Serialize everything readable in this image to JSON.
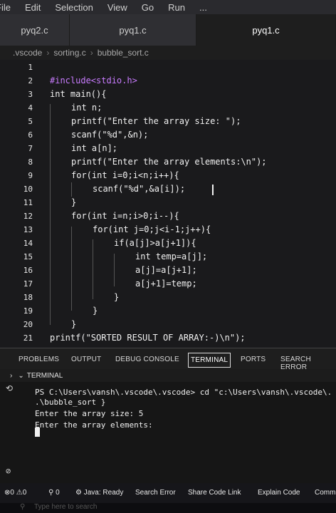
{
  "menubar": {
    "items": [
      "File",
      "Edit",
      "Selection",
      "View",
      "Go",
      "Run",
      "..."
    ]
  },
  "tabs": [
    {
      "label": "pyq2.c"
    },
    {
      "label": "pyq1.c"
    },
    {
      "label": "pyq1.c"
    }
  ],
  "breadcrumb": {
    "parts": [
      ".vscode",
      "sorting.c",
      "bubble_sort.c"
    ]
  },
  "editor": {
    "line_numbers": [
      "1",
      "2",
      "3",
      "4",
      "5",
      "6",
      "7",
      "8",
      "9",
      "10",
      "11",
      "12",
      "13",
      "14",
      "15",
      "16",
      "17",
      "18",
      "19",
      "20",
      "21"
    ],
    "lines": [
      "",
      "#include<stdio.h>",
      "int main(){",
      "    int n;",
      "    printf(\"Enter the array size: \");",
      "    scanf(\"%d\",&n);",
      "    int a[n];",
      "    printf(\"Enter the array elements:\\n\");",
      "    for(int i=0;i<n;i++){",
      "        scanf(\"%d\",&a[i]);",
      "    }",
      "    for(int i=n;i>0;i--){",
      "        for(int j=0;j<i-1;j++){",
      "            if(a[j]>a[j+1]){",
      "                int temp=a[j];",
      "                a[j]=a[j+1];",
      "                a[j+1]=temp;",
      "            }",
      "        }",
      "    }",
      "    printf(\"SORTED RESULT OF ARRAY:-)\\n\");"
    ]
  },
  "panel": {
    "tabs": [
      "PROBLEMS",
      "OUTPUT",
      "DEBUG CONSOLE",
      "TERMINAL",
      "PORTS",
      "SEARCH ERROR"
    ],
    "active_tab": "TERMINAL",
    "section_label": "TERMINAL"
  },
  "terminal": {
    "lines": [
      "PS C:\\Users\\vansh\\.vscode\\.vscode> cd \"c:\\Users\\vansh\\.vscode\\.",
      ".\\bubble_sort }",
      "Enter the array size: 5",
      "Enter the array elements:"
    ]
  },
  "statusbar": {
    "errors": "0",
    "warnings": "0",
    "ports": "0",
    "items": [
      "Java: Ready",
      "Search Error",
      "Share Code Link",
      "Explain Code",
      "Comm"
    ]
  },
  "taskbar": {
    "search_placeholder": "Type here to search"
  },
  "colors": {
    "editor_bg": "#1a1a1c",
    "panel_bg": "#161616",
    "tab_active_bg": "#1e1e1e"
  }
}
